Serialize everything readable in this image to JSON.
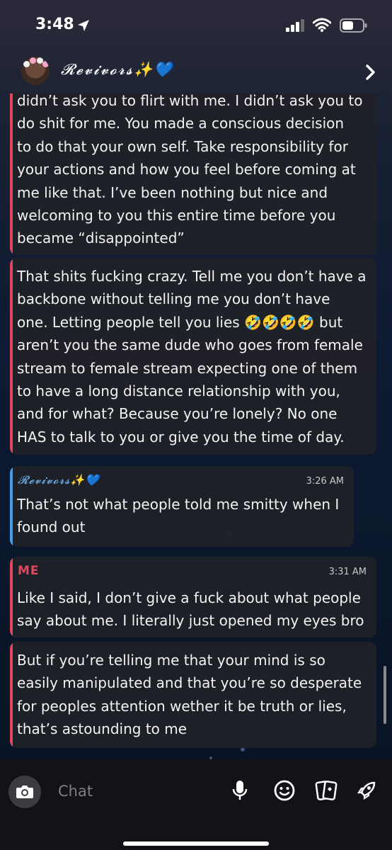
{
  "status_bar": {
    "time": "3:48",
    "icons": [
      "location-arrow-icon",
      "cellular-signal-icon",
      "wifi-icon",
      "battery-icon"
    ]
  },
  "header": {
    "title": "𝓡𝓮𝓿𝓲𝓿𝓸𝓻𝓼✨💙",
    "icons": [
      "avatar",
      "chevron-right-icon"
    ]
  },
  "messages": [
    {
      "side": "me",
      "lines": [
        "didn’t ask you to flirt with me. I didn’t ask you to",
        "do shit for me. You made a conscious decision",
        "to do that your own self. Take responsibility for",
        "your actions and how you feel before coming at",
        "me like that. I’ve been nothing but nice and",
        "welcoming to you this entire time before you",
        "became “disappointed”"
      ]
    },
    {
      "side": "me",
      "lines": [
        "That shits fucking crazy. Tell me you don’t have a",
        "backbone without telling me you don’t have",
        "one. Letting people tell you lies 🤣🤣🤣🤣 but",
        "aren’t you the same dude who goes from female",
        "stream to female stream expecting one of them",
        "to have a long distance relationship with you,",
        "and for what? Because you’re lonely? No one",
        "HAS to talk to you or give you the time of day."
      ]
    },
    {
      "side": "them",
      "sender": "𝓡𝓮𝓿𝓲𝓿𝓸𝓻𝓼✨💙",
      "time": "3:26 AM",
      "lines": [
        "That’s not what people told me smitty when I",
        "found out"
      ]
    },
    {
      "side": "me",
      "sender": "ME",
      "time": "3:31 AM",
      "lines": [
        "Like I said, I don’t give a fuck about what people",
        "say about me. I literally just opened my eyes bro"
      ]
    },
    {
      "side": "me",
      "lines": [
        "But if you’re telling me that your mind is so",
        "easily manipulated and that you’re so desperate",
        "for peoples attention wether it be truth or lies,",
        "that’s astounding to me"
      ]
    }
  ],
  "composer": {
    "placeholder": "Chat",
    "icons": [
      "camera-icon",
      "microphone-icon",
      "smiley-icon",
      "cards-icon",
      "rocket-icon"
    ]
  },
  "colors": {
    "me_accent": "#e0475d",
    "them_accent": "#3d9df0",
    "bubble_bg": "#202128",
    "bottom_bar_bg": "#121317"
  }
}
